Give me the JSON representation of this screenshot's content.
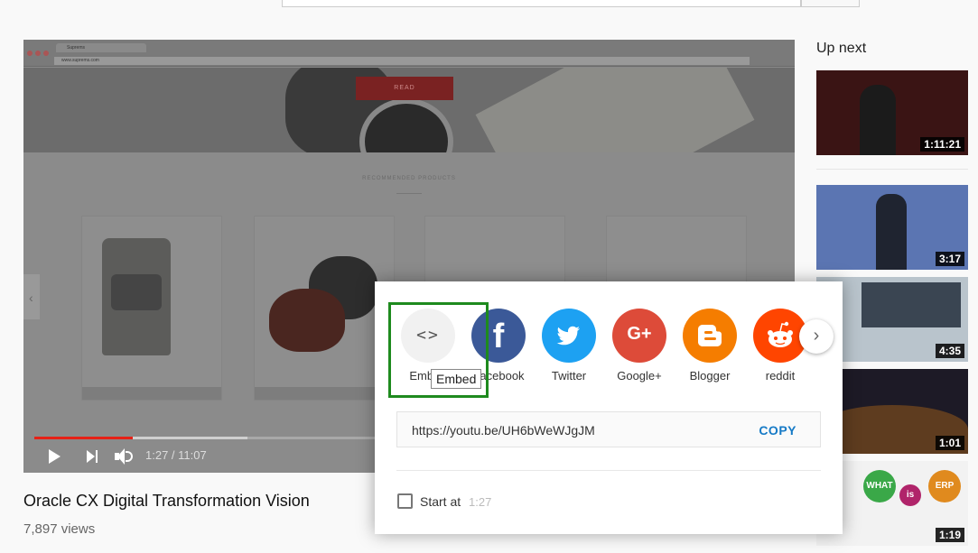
{
  "player": {
    "time_display": "1:27 / 11:07",
    "progress_fraction": 0.131,
    "screen": {
      "url": "www.suprems.com",
      "tab": "Suprems",
      "hero_button": "READ",
      "recommended_heading": "RECOMMENDED PRODUCTS"
    }
  },
  "video": {
    "title": "Oracle CX Digital Transformation Vision",
    "views": "7,897 views"
  },
  "sidebar": {
    "heading": "Up next",
    "items": [
      {
        "duration": "1:11:21"
      },
      {
        "duration": "3:17"
      },
      {
        "duration": "4:35"
      },
      {
        "duration": "1:01"
      },
      {
        "duration": "1:19",
        "bubbles": [
          "WHAT",
          "is",
          "ERP"
        ]
      }
    ]
  },
  "share": {
    "options": [
      {
        "label": "Embed",
        "icon": "code-brackets-icon",
        "color": "#f1f1f1"
      },
      {
        "label": "Facebook",
        "icon": "facebook-icon",
        "color": "#3b5998"
      },
      {
        "label": "Twitter",
        "icon": "twitter-bird-icon",
        "color": "#1da1f2"
      },
      {
        "label": "Google+",
        "icon": "google-plus-icon",
        "color": "#dd4b39"
      },
      {
        "label": "Blogger",
        "icon": "blogger-icon",
        "color": "#f57d00"
      },
      {
        "label": "reddit",
        "icon": "reddit-alien-icon",
        "color": "#ff4500"
      }
    ],
    "tooltip": "Embed",
    "url": "https://youtu.be/UH6bWeWJgJM",
    "copy_label": "COPY",
    "start_at_label": "Start at",
    "start_at_time": "1:27",
    "start_at_checked": false
  }
}
